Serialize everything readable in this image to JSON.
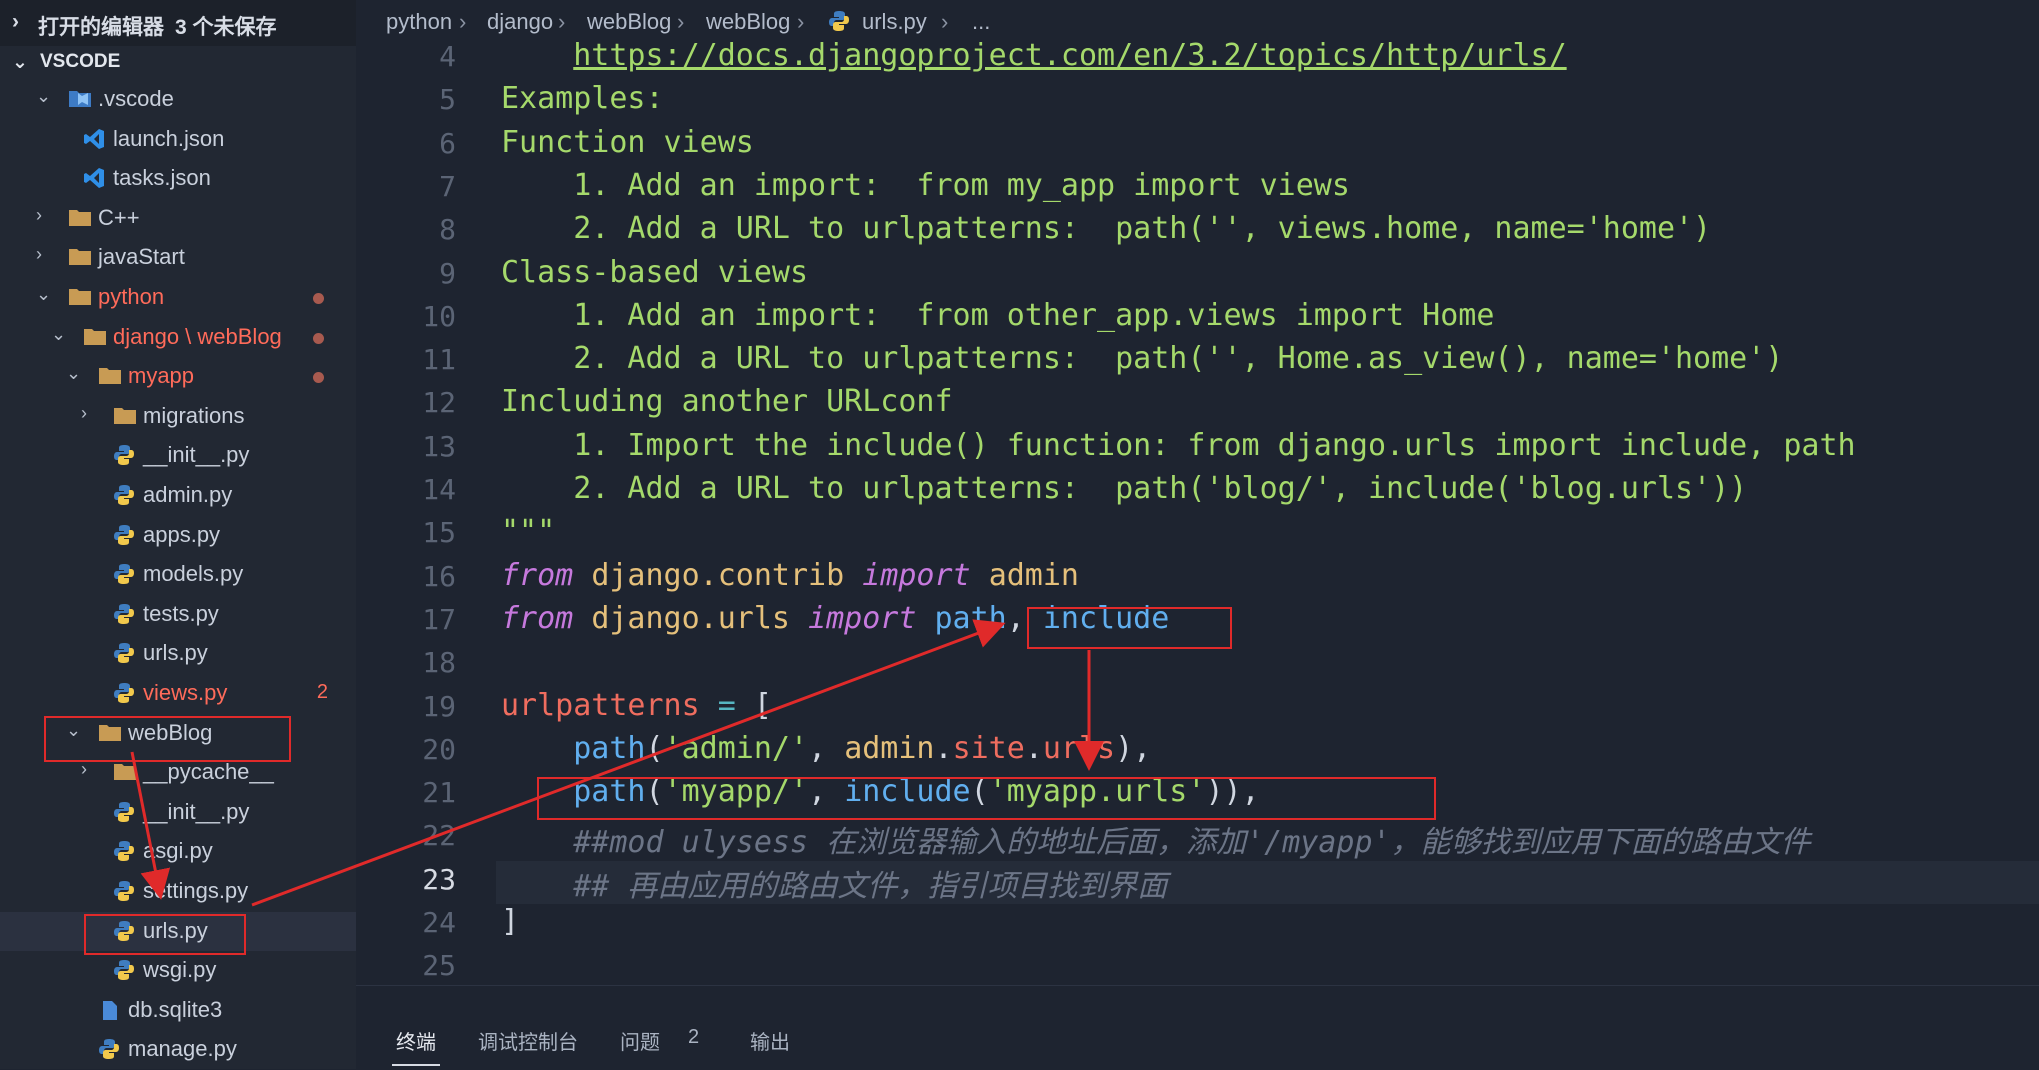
{
  "sidebar": {
    "open_editors_label": "打开的编辑器",
    "unsaved_label": "3 个未保存",
    "section_title": "VSCODE",
    "tree": [
      {
        "label": ".vscode",
        "kind": "vsfolder",
        "chev": "down"
      },
      {
        "label": "launch.json",
        "kind": "vsfile"
      },
      {
        "label": "tasks.json",
        "kind": "vsfile"
      },
      {
        "label": "C++",
        "kind": "folder",
        "chev": "right"
      },
      {
        "label": "javaStart",
        "kind": "folder",
        "chev": "right"
      },
      {
        "label": "python",
        "kind": "folder",
        "chev": "down",
        "modified": true
      },
      {
        "label": "django \\ webBlog",
        "kind": "folder",
        "chev": "down",
        "modified": true
      },
      {
        "label": "myapp",
        "kind": "folder",
        "chev": "down",
        "modified": true
      },
      {
        "label": "migrations",
        "kind": "folder",
        "chev": "right"
      },
      {
        "label": "__init__.py",
        "kind": "py"
      },
      {
        "label": "admin.py",
        "kind": "py"
      },
      {
        "label": "apps.py",
        "kind": "py"
      },
      {
        "label": "models.py",
        "kind": "py"
      },
      {
        "label": "tests.py",
        "kind": "py"
      },
      {
        "label": "urls.py",
        "kind": "py"
      },
      {
        "label": "views.py",
        "kind": "py",
        "modified": true,
        "badge": "2"
      },
      {
        "label": "webBlog",
        "kind": "folder",
        "chev": "down"
      },
      {
        "label": "__pycache__",
        "kind": "folder",
        "chev": "right"
      },
      {
        "label": "__init__.py",
        "kind": "py"
      },
      {
        "label": "asgi.py",
        "kind": "py"
      },
      {
        "label": "settings.py",
        "kind": "py"
      },
      {
        "label": "urls.py",
        "kind": "py",
        "selected": true
      },
      {
        "label": "wsgi.py",
        "kind": "py"
      },
      {
        "label": "db.sqlite3",
        "kind": "db"
      },
      {
        "label": "manage.py",
        "kind": "py"
      }
    ]
  },
  "breadcrumb": [
    "python",
    "django",
    "webBlog",
    "webBlog",
    "urls.py",
    "..."
  ],
  "editor": {
    "current_line": "23",
    "lines": [
      {
        "n": "4",
        "tokens": [
          {
            "c": "pl",
            "t": "    "
          },
          {
            "c": "u",
            "t": "https://docs.djangoproject.com/en/3.2/topics/http/urls/"
          }
        ]
      },
      {
        "n": "5",
        "tokens": [
          {
            "c": "s",
            "t": "Examples:"
          }
        ]
      },
      {
        "n": "6",
        "tokens": [
          {
            "c": "s",
            "t": "Function views"
          }
        ]
      },
      {
        "n": "7",
        "tokens": [
          {
            "c": "s",
            "t": "    1. Add an import:  from my_app import views"
          }
        ]
      },
      {
        "n": "8",
        "tokens": [
          {
            "c": "s",
            "t": "    2. Add a URL to urlpatterns:  path('', views.home, name='home')"
          }
        ]
      },
      {
        "n": "9",
        "tokens": [
          {
            "c": "s",
            "t": "Class-based views"
          }
        ]
      },
      {
        "n": "10",
        "tokens": [
          {
            "c": "s",
            "t": "    1. Add an import:  from other_app.views import Home"
          }
        ]
      },
      {
        "n": "11",
        "tokens": [
          {
            "c": "s",
            "t": "    2. Add a URL to urlpatterns:  path('', Home.as_view(), name='home')"
          }
        ]
      },
      {
        "n": "12",
        "tokens": [
          {
            "c": "s",
            "t": "Including another URLconf"
          }
        ]
      },
      {
        "n": "13",
        "tokens": [
          {
            "c": "s",
            "t": "    1. Import the include() function: from django.urls import include, path"
          }
        ]
      },
      {
        "n": "14",
        "tokens": [
          {
            "c": "s",
            "t": "    2. Add a URL to urlpatterns:  path('blog/', include('blog.urls'))"
          }
        ]
      },
      {
        "n": "15",
        "tokens": [
          {
            "c": "s",
            "t": "\"\"\""
          }
        ]
      },
      {
        "n": "16",
        "tokens": [
          {
            "c": "kw",
            "t": "from"
          },
          {
            "c": "pl",
            "t": " "
          },
          {
            "c": "id",
            "t": "django.contrib"
          },
          {
            "c": "pl",
            "t": " "
          },
          {
            "c": "kw",
            "t": "import"
          },
          {
            "c": "pl",
            "t": " "
          },
          {
            "c": "id",
            "t": "admin"
          }
        ]
      },
      {
        "n": "17",
        "tokens": [
          {
            "c": "kw",
            "t": "from"
          },
          {
            "c": "pl",
            "t": " "
          },
          {
            "c": "id",
            "t": "django.urls"
          },
          {
            "c": "pl",
            "t": " "
          },
          {
            "c": "kw",
            "t": "import"
          },
          {
            "c": "pl",
            "t": " "
          },
          {
            "c": "fn",
            "t": "path"
          },
          {
            "c": "pl",
            "t": ", "
          },
          {
            "c": "fn",
            "t": "include"
          }
        ]
      },
      {
        "n": "18",
        "tokens": []
      },
      {
        "n": "19",
        "tokens": [
          {
            "c": "vn",
            "t": "urlpatterns"
          },
          {
            "c": "pl",
            "t": " "
          },
          {
            "c": "op",
            "t": "="
          },
          {
            "c": "pl",
            "t": " ["
          }
        ]
      },
      {
        "n": "20",
        "tokens": [
          {
            "c": "pl",
            "t": "    "
          },
          {
            "c": "fn",
            "t": "path"
          },
          {
            "c": "pl",
            "t": "("
          },
          {
            "c": "s",
            "t": "'admin/'"
          },
          {
            "c": "pl",
            "t": ", "
          },
          {
            "c": "id",
            "t": "admin"
          },
          {
            "c": "pl",
            "t": "."
          },
          {
            "c": "vn",
            "t": "site"
          },
          {
            "c": "pl",
            "t": "."
          },
          {
            "c": "vn",
            "t": "urls"
          },
          {
            "c": "pl",
            "t": "),"
          }
        ]
      },
      {
        "n": "21",
        "tokens": [
          {
            "c": "pl",
            "t": "    "
          },
          {
            "c": "fn",
            "t": "path"
          },
          {
            "c": "pl",
            "t": "("
          },
          {
            "c": "s",
            "t": "'myapp/'"
          },
          {
            "c": "pl",
            "t": ", "
          },
          {
            "c": "fn",
            "t": "include"
          },
          {
            "c": "pl",
            "t": "("
          },
          {
            "c": "s",
            "t": "'myapp.urls'"
          },
          {
            "c": "pl",
            "t": ")),"
          }
        ]
      },
      {
        "n": "22",
        "tokens": [
          {
            "c": "pl",
            "t": "    "
          },
          {
            "c": "cm",
            "t": "##mod ulysess 在浏览器输入的地址后面，添加'/myapp'，能够找到应用下面的路由文件"
          }
        ]
      },
      {
        "n": "23",
        "tokens": [
          {
            "c": "pl",
            "t": "    "
          },
          {
            "c": "cm",
            "t": "## 再由应用的路由文件，指引项目找到界面"
          }
        ]
      },
      {
        "n": "24",
        "tokens": [
          {
            "c": "pl",
            "t": "]"
          }
        ]
      },
      {
        "n": "25",
        "tokens": []
      }
    ]
  },
  "panel": {
    "tabs": [
      "终端",
      "调试控制台",
      "问题",
      "输出"
    ],
    "problems_count": "2"
  },
  "colors": {
    "annotation": "#e02a2a",
    "modified": "#ff6b5a",
    "string": "#a5d96b",
    "keyword": "#c679dd"
  }
}
